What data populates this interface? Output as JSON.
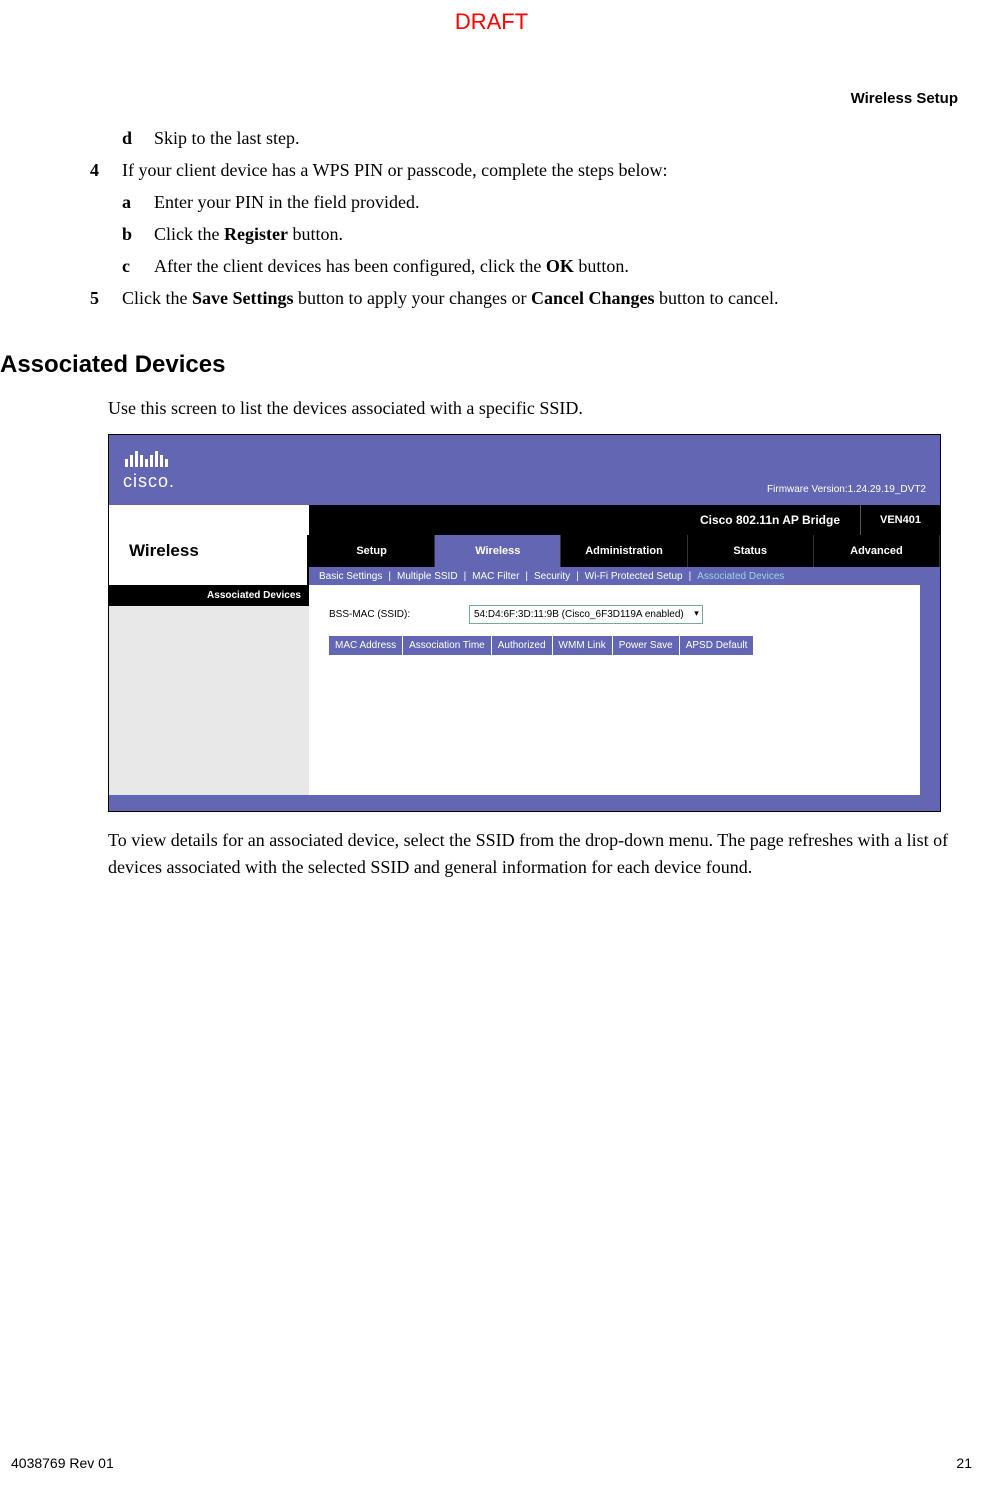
{
  "watermark": "DRAFT",
  "header": {
    "section": "Wireless Setup"
  },
  "steps": {
    "d_marker": "d",
    "d_text": "Skip to the last step.",
    "s4_marker": "4",
    "s4_text": "If your client device has a WPS PIN or passcode, complete the steps below:",
    "s4a_marker": "a",
    "s4a_text": "Enter your PIN in the field provided.",
    "s4b_marker": "b",
    "s4b_pre": "Click the ",
    "s4b_bold": "Register",
    "s4b_post": " button.",
    "s4c_marker": "c",
    "s4c_pre": "After the client devices has been configured, click the ",
    "s4c_bold": "OK",
    "s4c_post": " button.",
    "s5_marker": "5",
    "s5_pre": "Click the ",
    "s5_b1": "Save Settings",
    "s5_mid": " button to apply your changes or ",
    "s5_b2": "Cancel Changes",
    "s5_post": " button to cancel."
  },
  "section_heading": "Associated Devices",
  "intro_para": "Use this screen to list the devices associated with a specific SSID.",
  "router": {
    "logo_text": "cisco.",
    "firmware": "Firmware Version:1.24.29.19_DVT2",
    "bridge": "Cisco 802.11n AP Bridge",
    "model": "VEN401",
    "left_nav_label": "Wireless",
    "tabs": [
      "Setup",
      "Wireless",
      "Administration",
      "Status",
      "Advanced"
    ],
    "active_tab_index": 1,
    "subtabs": [
      "Basic Settings",
      "Multiple SSID",
      "MAC Filter",
      "Security",
      "Wi-Fi Protected Setup",
      "Associated Devices"
    ],
    "active_subtab_index": 5,
    "section_label": "Associated Devices",
    "field_label": "BSS-MAC (SSID):",
    "select_value": "54:D4:6F:3D:11:9B (Cisco_6F3D119A enabled)",
    "table_headers": [
      "MAC Address",
      "Association Time",
      "Authorized",
      "WMM Link",
      "Power Save",
      "APSD Default"
    ]
  },
  "outro_para": "To view details for an associated device, select the SSID from the drop-down menu. The page refreshes with a list of devices associated with the selected SSID and general information for each device found.",
  "footer": {
    "left": "4038769 Rev 01",
    "right": "21"
  }
}
